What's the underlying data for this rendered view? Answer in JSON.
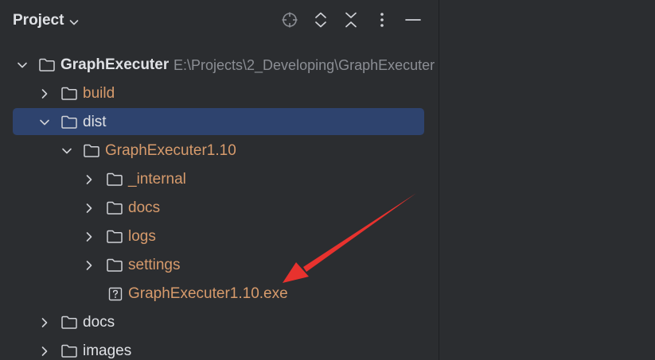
{
  "panel": {
    "title": "Project",
    "tools": [
      "crosshair-icon",
      "expand-all-icon",
      "collapse-all-icon",
      "more-vertical-icon",
      "minimize-icon"
    ]
  },
  "tree": {
    "root": {
      "name": "GraphExecuter",
      "path": "E:\\Projects\\2_Developing\\GraphExecuter"
    },
    "build": "build",
    "dist": "dist",
    "release": "GraphExecuter1.10",
    "internal": "_internal",
    "docs_inner": "docs",
    "logs": "logs",
    "settings": "settings",
    "exe": "GraphExecuter1.10.exe",
    "docs": "docs",
    "images": "images"
  },
  "colors": {
    "background": "#2b2d30",
    "selection": "#2e436e",
    "excluded_text": "#d79b6c",
    "text": "#dfe1e5",
    "annotation_arrow": "#e8322e"
  }
}
